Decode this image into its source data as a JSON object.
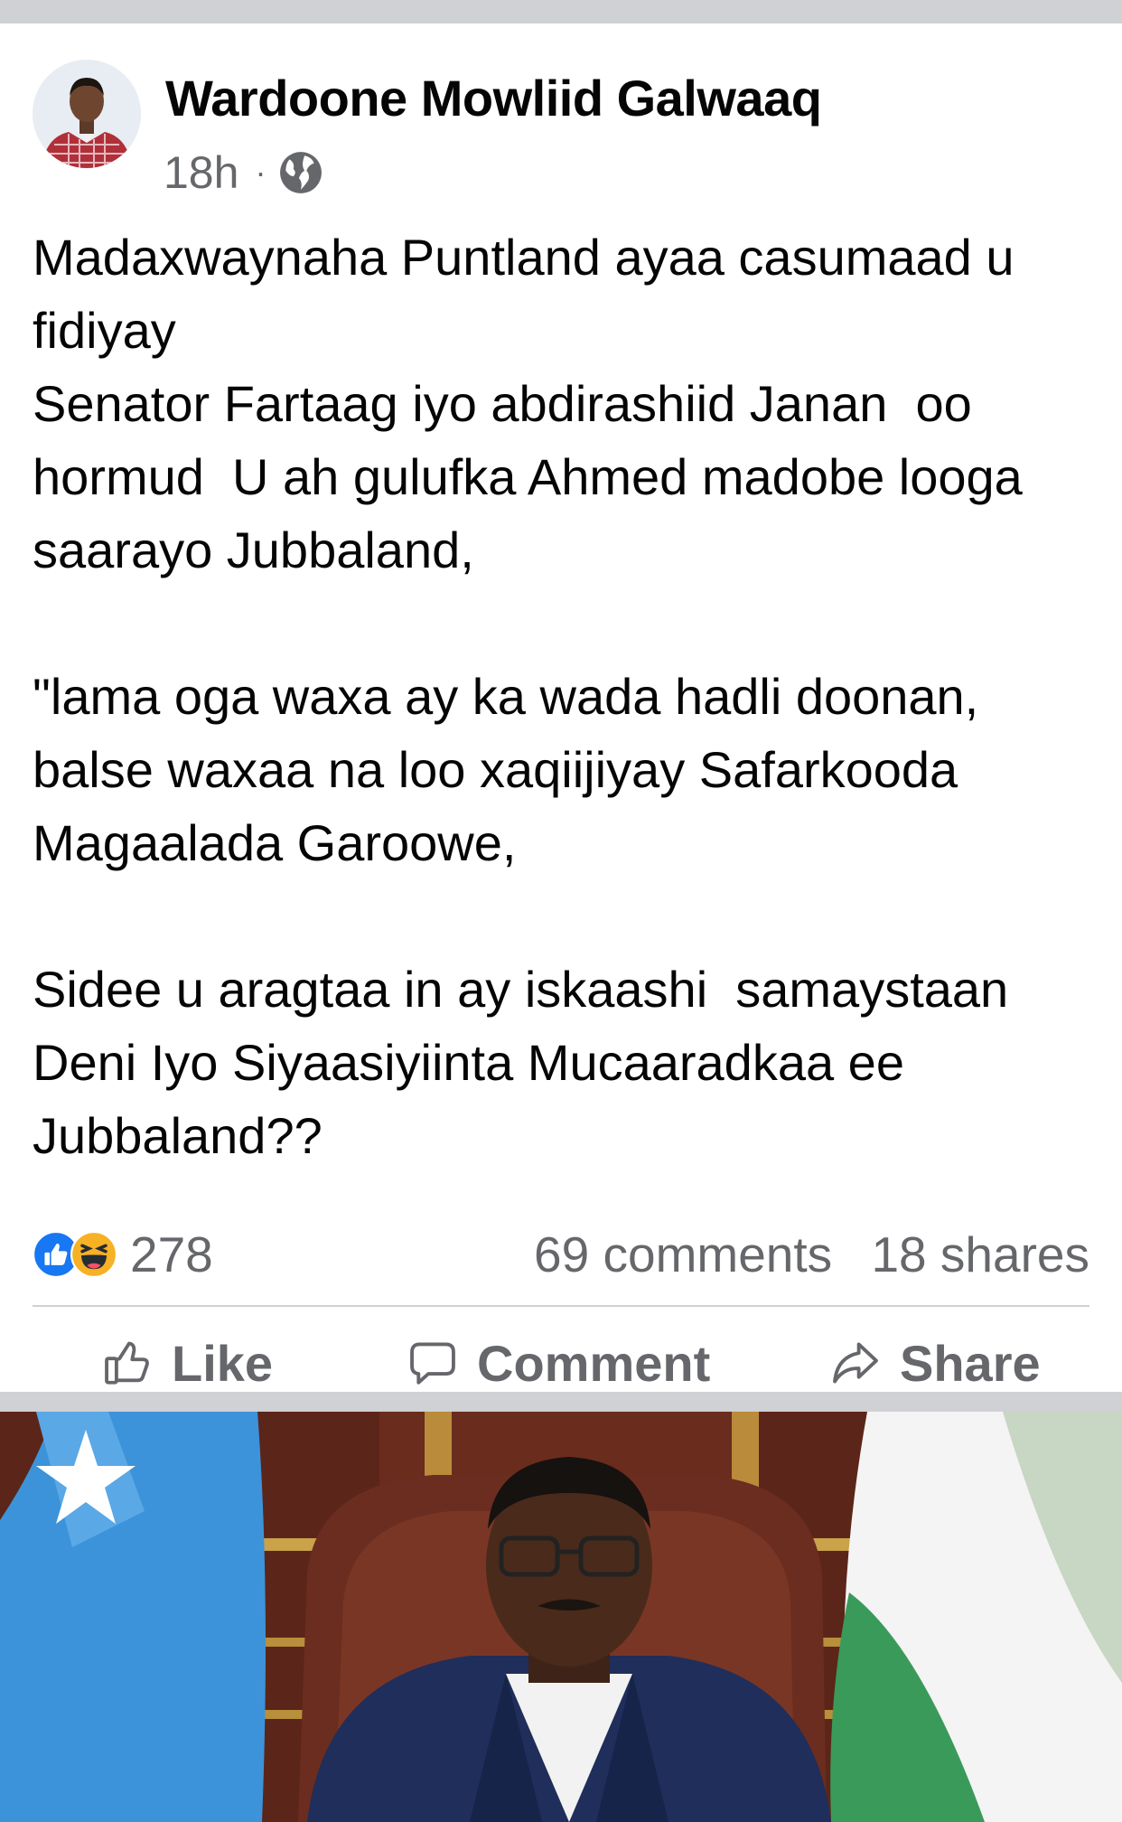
{
  "post": {
    "author": "Wardoone Mowliid Galwaaq",
    "time": "18h",
    "separator": "·",
    "privacy_icon": "globe-icon",
    "text": "Madaxwaynaha Puntland ayaa casumaad u\nfidiyay\nSenator Fartaag iyo abdirashiid Janan  oo\nhormud  U ah gulufka Ahmed madobe looga\nsaarayo Jubbaland,\n\n\"lama oga waxa ay ka wada hadli doonan,\nbalse waxaa na loo xaqiijiyay Safarkooda\nMagaalada Garoowe,\n\nSidee u aragtaa in ay iskaashi  samaystaan\nDeni Iyo Siyaasiyiinta Mucaaradkaa ee\nJubbaland??"
  },
  "engagement": {
    "reaction_icons": [
      "like-icon",
      "haha-icon"
    ],
    "reaction_count": "278",
    "comments": "69 comments",
    "shares": "18 shares"
  },
  "actions": {
    "like": "Like",
    "comment": "Comment",
    "share": "Share"
  },
  "colors": {
    "like_blue": "#1877f2",
    "haha_yellow": "#f7b125",
    "secondary_text": "#65676b",
    "divider": "#ced0d4"
  }
}
